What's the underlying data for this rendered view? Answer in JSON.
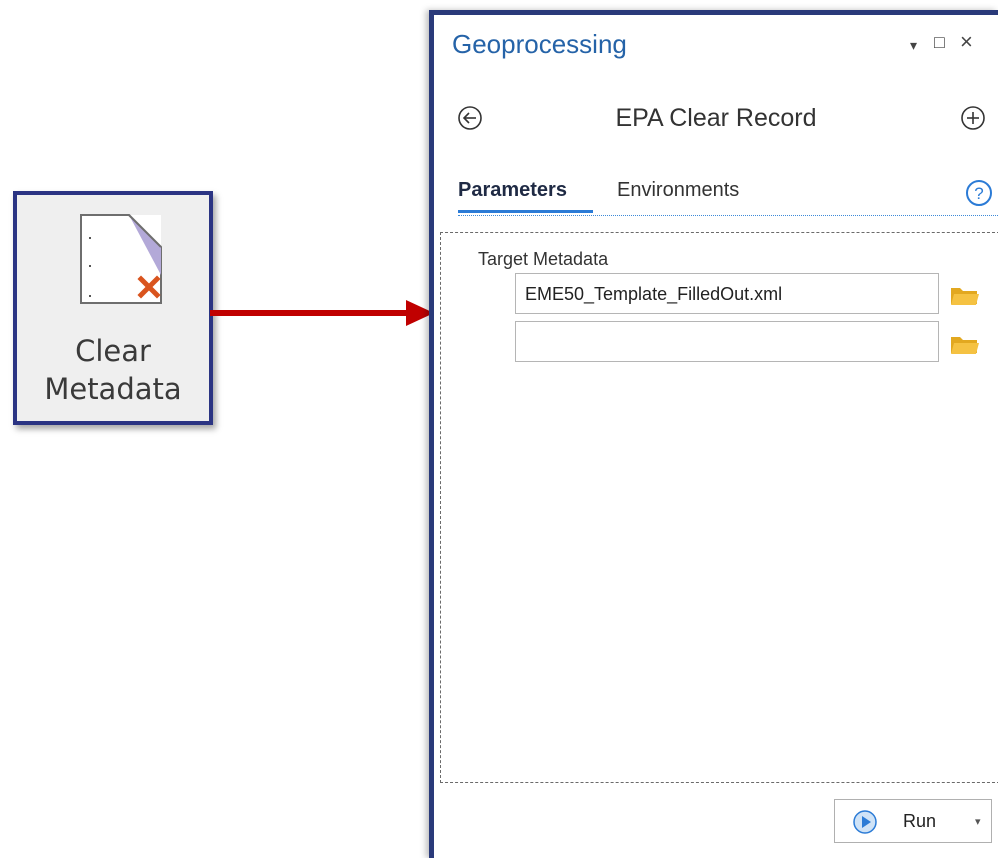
{
  "ribbon_button": {
    "line1": "Clear",
    "line2": "Metadata",
    "icon": "clear-metadata-icon"
  },
  "pane": {
    "title": "Geoprocessing",
    "controls": {
      "dropdown": "▾",
      "maximize": "□",
      "close": "×"
    },
    "tool_title": "EPA Clear Record",
    "tabs": [
      {
        "label": "Parameters",
        "active": true
      },
      {
        "label": "Environments",
        "active": false
      }
    ],
    "help_glyph": "?",
    "parameter": {
      "label": "Target Metadata",
      "values": [
        "EME50_Template_FilledOut.xml",
        ""
      ]
    },
    "run_label": "Run",
    "run_dropdown": "▾"
  },
  "colors": {
    "accent": "#2563a8",
    "border": "#2b3483",
    "arrow": "#c00000",
    "folder": "#f5c242",
    "close_x": "#d9541e"
  }
}
